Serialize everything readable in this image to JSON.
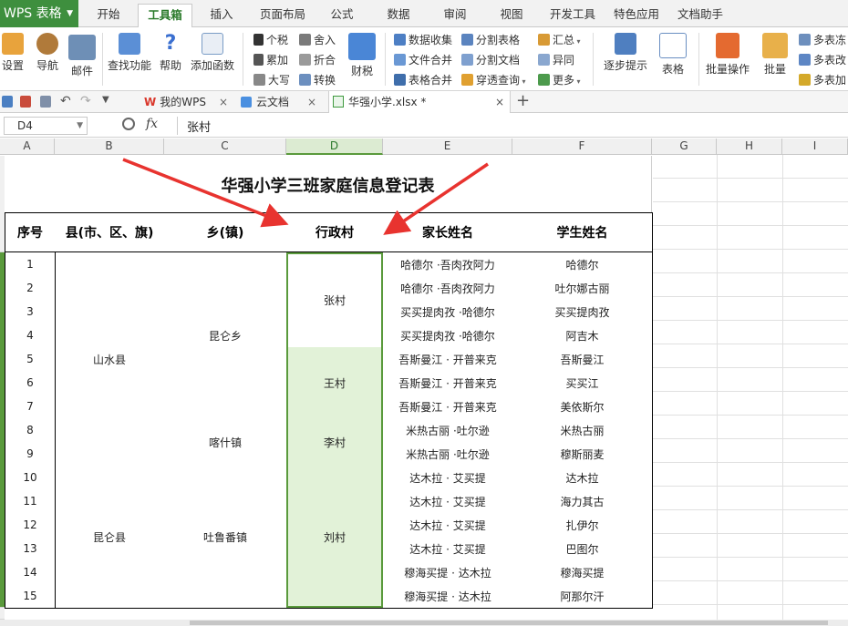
{
  "app": {
    "logo": "WPS 表格"
  },
  "ribbon_tabs": [
    "开始",
    "工具箱",
    "插入",
    "页面布局",
    "公式",
    "数据",
    "审阅",
    "视图",
    "开发工具",
    "特色应用",
    "文档助手"
  ],
  "ribbon": {
    "settings": "设置",
    "nav": "导航",
    "mail": "邮件",
    "find": "查找功能",
    "help": "帮助",
    "add_func": "添加函数",
    "tax": "个税",
    "sum": "累加",
    "upper": "大写",
    "round": "舍入",
    "fold": "折合",
    "convert": "转换",
    "finance": "财税",
    "collect": "数据收集",
    "file_merge": "文件合并",
    "table_merge": "表格合并",
    "split_table": "分割表格",
    "split_doc": "分割文档",
    "cross_query": "穿透查询",
    "summary": "汇总",
    "diff": "异同",
    "more": "更多",
    "step": "逐步提示",
    "table": "表格",
    "batch_op": "批量操作",
    "batch": "批量",
    "multi1": "多表冻",
    "multi2": "多表改",
    "multi3": "多表加"
  },
  "doc_tabs": {
    "mywps": "我的WPS",
    "cloud": "云文档",
    "file": "华强小学.xlsx *"
  },
  "formula": {
    "cell_ref": "D4",
    "fx": "fx",
    "value": "张村"
  },
  "columns": [
    "A",
    "B",
    "C",
    "D",
    "E",
    "F",
    "G",
    "H",
    "I"
  ],
  "sheet": {
    "title": "华强小学三班家庭信息登记表",
    "headers": [
      "序号",
      "县(市、区、旗)",
      "乡(镇)",
      "行政村",
      "家长姓名",
      "学生姓名"
    ],
    "counties": [
      "山水县",
      "昆仑县"
    ],
    "towns": [
      "昆仑乡",
      "喀什镇",
      "吐鲁番镇"
    ],
    "villages": [
      "张村",
      "王村",
      "李村",
      "刘村"
    ],
    "rows": [
      {
        "no": "1",
        "parent": "哈德尔 ·吾肉孜阿力",
        "student": "哈德尔"
      },
      {
        "no": "2",
        "parent": "哈德尔 ·吾肉孜阿力",
        "student": "吐尔娜古丽"
      },
      {
        "no": "3",
        "parent": "买买提肉孜 ·哈德尔",
        "student": "买买提肉孜"
      },
      {
        "no": "4",
        "parent": "买买提肉孜 ·哈德尔",
        "student": "阿吉木"
      },
      {
        "no": "5",
        "parent": "吾斯曼江 · 开普来克",
        "student": "吾斯曼江"
      },
      {
        "no": "6",
        "parent": "吾斯曼江 · 开普来克",
        "student": "买买江"
      },
      {
        "no": "7",
        "parent": "吾斯曼江 · 开普来克",
        "student": "美依斯尔"
      },
      {
        "no": "8",
        "parent": "米热古丽 ·吐尔逊",
        "student": "米热古丽"
      },
      {
        "no": "9",
        "parent": "米热古丽 ·吐尔逊",
        "student": "穆斯丽麦"
      },
      {
        "no": "10",
        "parent": "达木拉 · 艾买提",
        "student": "达木拉"
      },
      {
        "no": "11",
        "parent": "达木拉 · 艾买提",
        "student": "海力其古"
      },
      {
        "no": "12",
        "parent": "达木拉 · 艾买提",
        "student": "扎伊尔"
      },
      {
        "no": "13",
        "parent": "达木拉 · 艾买提",
        "student": "巴图尔"
      },
      {
        "no": "14",
        "parent": "穆海买提 · 达木拉",
        "student": "穆海买提"
      },
      {
        "no": "15",
        "parent": "穆海买提 · 达木拉",
        "student": "阿那尔汗"
      }
    ]
  },
  "colors": {
    "wps_green": "#3e8f3e",
    "selection": "#5a9a3c",
    "selected_fill": "#e2f2d8",
    "arrow": "#e8332f"
  }
}
